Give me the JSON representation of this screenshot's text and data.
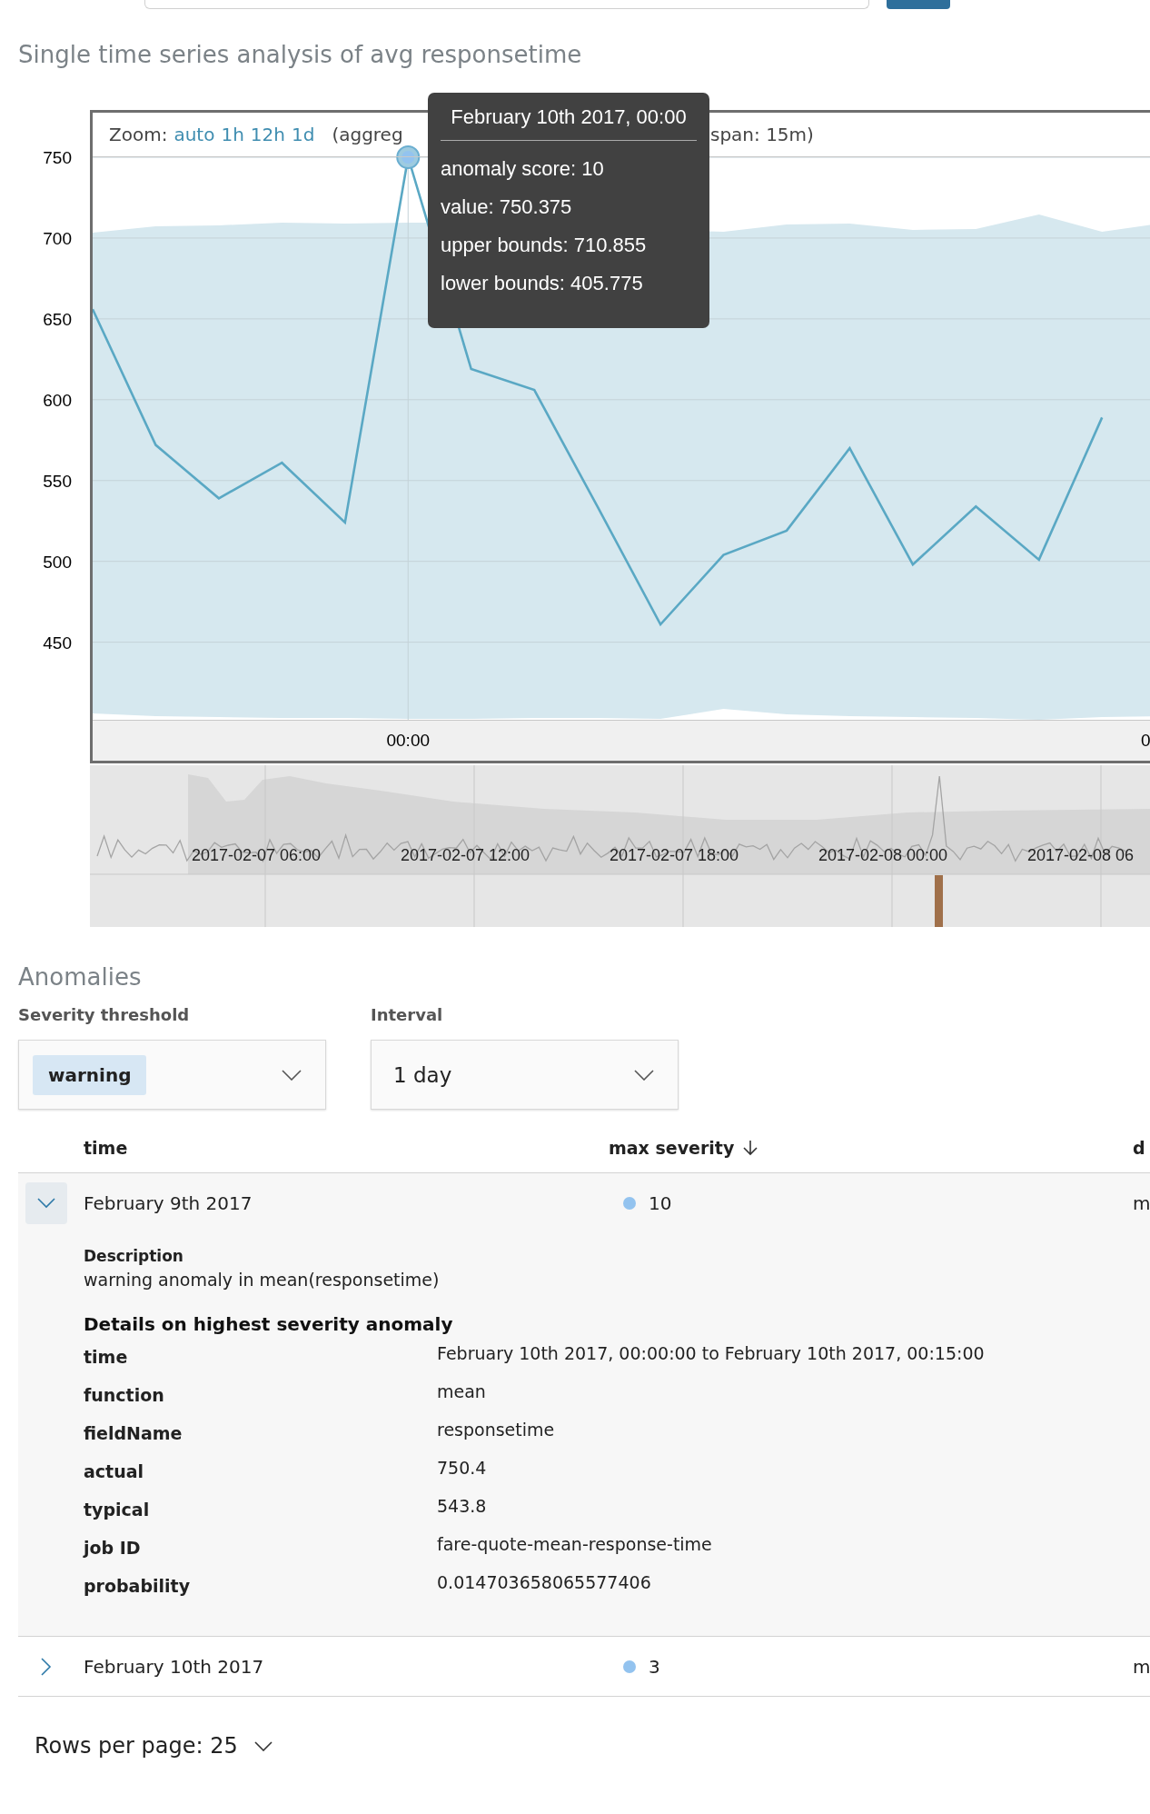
{
  "title": "Single time series analysis of avg responsetime",
  "chart": {
    "zoom_label": "Zoom:",
    "zoom_options": [
      {
        "label": "auto"
      },
      {
        "label": "1h"
      },
      {
        "label": "12h"
      },
      {
        "label": "1d"
      }
    ],
    "aggregation_note_start": "(aggreg",
    "aggregation_note_end": "span: 15m)",
    "chart_data": {
      "type": "line",
      "annotations": [
        {
          "text": "00:00"
        },
        {
          "text": "0"
        }
      ],
      "grid": true,
      "ylim": [
        402,
        750
      ],
      "yticks": [
        {
          "value": 450,
          "label": "450"
        },
        {
          "value": 500,
          "label": "500"
        },
        {
          "value": 550,
          "label": "550"
        },
        {
          "value": 600,
          "label": "600"
        },
        {
          "value": 650,
          "label": "650"
        },
        {
          "value": 700,
          "label": "700"
        },
        {
          "value": 750,
          "label": "750"
        }
      ],
      "series": [
        {
          "color": "#5aa8c4",
          "values": [
            656,
            572,
            539,
            561,
            524,
            750,
            619,
            606,
            534,
            461,
            504,
            519,
            570,
            498,
            534,
            501,
            589
          ]
        }
      ]
    },
    "tooltip": {
      "title": "February 10th 2017, 00:00",
      "lines": [
        "anomaly score: 10",
        "value: 750.375",
        "upper bounds: 710.855",
        "lower bounds: 405.775"
      ]
    }
  },
  "overview": {
    "labels": [
      "2017-02-07 06:00",
      "2017-02-07 12:00",
      "2017-02-07 18:00",
      "2017-02-08 00:00",
      "2017-02-08 06"
    ]
  },
  "anomalies": {
    "title": "Anomalies",
    "severity_threshold": {
      "label": "Severity threshold",
      "value": "warning"
    },
    "interval": {
      "label": "Interval",
      "value": "1 day"
    },
    "table": {
      "columns": [
        {
          "label": "time",
          "sorted": false
        },
        {
          "label": "max severity",
          "sorted": true
        },
        {
          "label": "d",
          "sorted": false
        }
      ],
      "rows": [
        {
          "expanded": true,
          "time": "February 9th 2017",
          "max_severity": "10",
          "color": "#93c3ef",
          "column_3": "m",
          "details": {
            "description_label": "Description",
            "description": "warning anomaly in mean(responsetime)",
            "heading": "Details on highest severity anomaly",
            "fields": [
              {
                "label": "time",
                "value": "February 10th 2017, 00:00:00 to February 10th 2017, 00:15:00"
              },
              {
                "label": "function",
                "value": "mean"
              },
              {
                "label": "fieldName",
                "value": "responsetime"
              },
              {
                "label": "actual",
                "value": "750.4"
              },
              {
                "label": "typical",
                "value": "543.8"
              },
              {
                "label": "job ID",
                "value": "fare-quote-mean-response-time"
              },
              {
                "label": "probability",
                "value": "0.014703658065577406"
              }
            ]
          }
        },
        {
          "expanded": false,
          "time": "February 10th 2017",
          "max_severity": "3",
          "color": "#93c3ef",
          "column_3": "m"
        }
      ]
    },
    "rows_per_page": "Rows per page: 25"
  }
}
